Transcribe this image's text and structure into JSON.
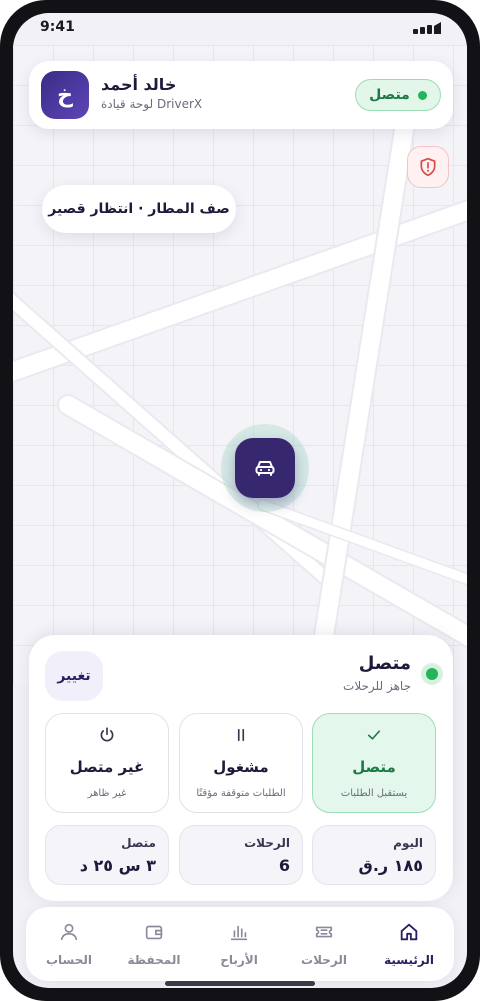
{
  "status_bar": {
    "time": "9:41"
  },
  "profile": {
    "initial": "خ",
    "name": "خالد أحمد",
    "subtitle": "لوحة قيادة DriverX",
    "status_pill": "متصل"
  },
  "map": {
    "queue_label": "صف المطار · انتظار قصير"
  },
  "panel": {
    "status_title": "متصل",
    "status_subtitle": "جاهز للرحلات",
    "change_button": "تغيير",
    "options": [
      {
        "icon": "check-icon",
        "label": "متصل",
        "sub": "يستقبل الطلبات",
        "active": true
      },
      {
        "icon": "pause-icon",
        "label": "مشغول",
        "sub": "الطلبات متوقفة مؤقتًا",
        "active": false
      },
      {
        "icon": "power-icon",
        "label": "غير متصل",
        "sub": "غير ظاهر",
        "active": false
      }
    ],
    "stats": [
      {
        "label": "اليوم",
        "value": "١٨٥ ر.ق"
      },
      {
        "label": "الرحلات",
        "value": "6"
      },
      {
        "label": "متصل",
        "value": "٣ س ٢٥ د"
      }
    ]
  },
  "nav": [
    {
      "icon": "home-icon",
      "label": "الرئيسية",
      "active": true
    },
    {
      "icon": "ticket-icon",
      "label": "الرحلات",
      "active": false
    },
    {
      "icon": "bar-chart-icon",
      "label": "الأرباح",
      "active": false
    },
    {
      "icon": "wallet-icon",
      "label": "المحفظة",
      "active": false
    },
    {
      "icon": "user-icon",
      "label": "الحساب",
      "active": false
    }
  ],
  "colors": {
    "brand": "#37276f",
    "online": "#22b55a",
    "online_text": "#1e7a45",
    "alert": "#d94a4a"
  }
}
